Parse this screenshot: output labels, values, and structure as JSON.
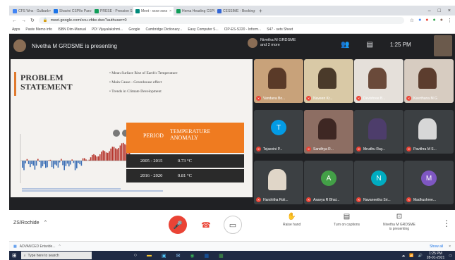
{
  "browser": {
    "tabs": [
      {
        "label": "CFS Wns - Gulbarb",
        "color": "#4285f4",
        "active": false
      },
      {
        "label": "Shavini CSPIlo Pars",
        "color": "#1a73e8",
        "active": false
      },
      {
        "label": "PRESE - Pression Sn",
        "color": "#0f9d58",
        "active": false
      },
      {
        "label": "Meet - xxxx-xxxx",
        "color": "#00897b",
        "active": true
      },
      {
        "label": "Hema Heading CSPL",
        "color": "#0f9d58",
        "active": false
      },
      {
        "label": "CESSIME - Booking",
        "color": "#3367d6",
        "active": false
      }
    ],
    "window_controls": {
      "minimize": "–",
      "maximize": "□",
      "close": "×"
    },
    "url": "meet.google.com/ccu-vfdw-dwx?authuser=0",
    "bookmarks": [
      "Apps",
      "Paste Memo info",
      "ISBN Dim-Manual",
      "PD! Vijayalakshmi...",
      "Google",
      "Cambridge Dictionary...",
      "Easy Computer S...",
      "ClP-ES-S220 - Inform...",
      "S47 - sets Sheet"
    ]
  },
  "meet": {
    "presenting_text": "Nivetha M GRDSME is presenting",
    "presenter_label": "Nivetha M GRDSME",
    "presenter_sub": "and 2 more",
    "clock": "1:25 PM",
    "meeting_code": "ZS/Rochide",
    "controls": {
      "raise_hand": "Raise hand",
      "captions": "Turn on captions",
      "presenting_name": "Nivetha M GRDSME",
      "presenting_sub": "is presenting"
    }
  },
  "slide": {
    "title_line1": "PROBLEM",
    "title_line2": "STATEMENT",
    "bullets": [
      "• Mean Surface Rise of Earth's Temperature",
      "• Main Cause - Greenhouse effect",
      "• Trends in Climate Development"
    ],
    "table": {
      "header_col1": "PERIOD",
      "header_col2": "TEMPERATURE ANOMALY",
      "rows": [
        {
          "period": "2005 - 2015",
          "value": "0.73 °C"
        },
        {
          "period": "2016 - 2020",
          "value": "0.81 °C"
        }
      ]
    }
  },
  "participants": [
    {
      "name": "Vandana Bo...",
      "type": "photo",
      "bg": "#c8a27a",
      "face": "#5a3a28"
    },
    {
      "name": "Naveen Kr...",
      "type": "photo",
      "bg": "#d9c9a6",
      "face": "#4a3a2a"
    },
    {
      "name": "Devishree B...",
      "type": "photo",
      "bg": "#e5e0da",
      "face": "#6a4a3a"
    },
    {
      "name": "Keerthana M G",
      "type": "photo",
      "bg": "#d7ccc1",
      "face": "#5c3d2e"
    },
    {
      "name": "Tejasvini P...",
      "type": "letter",
      "letter": "T",
      "bg": "#039be5"
    },
    {
      "name": "Sandhya R...",
      "type": "photo",
      "bg": "#8d6e63",
      "face": "#3e2723"
    },
    {
      "name": "Mrudhu Ray...",
      "type": "photo",
      "bg": "#3c4043",
      "face": "#4d3d6b"
    },
    {
      "name": "Pavithra M S...",
      "type": "photo",
      "bg": "#3c4043",
      "face": "#d7d7d7"
    },
    {
      "name": "Harshitha Roli...",
      "type": "photo",
      "bg": "#3c4043",
      "face": "#e0d6c8"
    },
    {
      "name": "Asavya R Bhat...",
      "type": "letter",
      "letter": "A",
      "bg": "#43a047"
    },
    {
      "name": "Navaneetha Sri...",
      "type": "letter",
      "letter": "N",
      "bg": "#00acc1"
    },
    {
      "name": "Madhushree...",
      "type": "letter",
      "letter": "M",
      "bg": "#7e57c2"
    }
  ],
  "downloads": {
    "file": "ADVANCED Entwide...",
    "show_all": "Show all"
  },
  "taskbar": {
    "search_placeholder": "Type here to search",
    "time": "1:25 PM",
    "date": "28-01-2021"
  },
  "colors": {
    "accent_orange": "#ef7b20",
    "meet_dark": "#202124",
    "tile": "#3c4043",
    "mic_red": "#ea4335"
  }
}
